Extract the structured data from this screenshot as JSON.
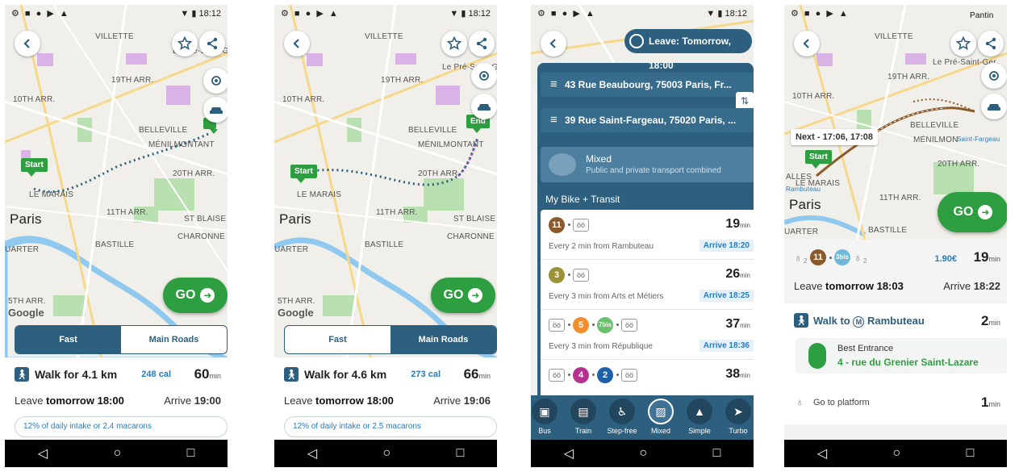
{
  "status": {
    "icons_left": "⚙ ■ ● ▶ ▲",
    "icons_right": "▼ ▮ 18:12"
  },
  "icons": {
    "back": "back-icon",
    "star": "star-icon",
    "share": "share-icon",
    "locate": "locate-icon",
    "car": "car-icon"
  },
  "colors": {
    "primary": "#2d5f7e",
    "green": "#2e9f40",
    "route_dots": "#2d5f7e",
    "accent_blue": "#2a7bbd"
  },
  "map": {
    "labels": {
      "villette": "VILLETTE",
      "arr19": "19TH ARR.",
      "arr10": "10TH ARR.",
      "belleville": "BELLEVILLE",
      "menilmontant": "MÉNILMONTANT",
      "arr20": "20TH ARR.",
      "lemarais": "LE MARAIS",
      "paris": "Paris",
      "arr11": "11TH ARR.",
      "stblaise": "ST BLAISE",
      "charonne": "CHARONNE",
      "bastille": "BASTILLE",
      "quartier": "UARTER",
      "arr5": "5TH ARR.",
      "lepre": "Le Pré-Saint-Ger",
      "pantin": "Pantin",
      "google": "Google"
    }
  },
  "pins": {
    "start": "Start",
    "end": "End"
  },
  "go": {
    "label": "GO",
    "arrow": "➜"
  },
  "phone1": {
    "tabs": [
      "Fast",
      "Main Roads"
    ],
    "walk_text": "Walk for 4.1 km",
    "calories": "248 cal",
    "minutes": "60",
    "min_unit": "min",
    "leave_prefix": "Leave ",
    "leave_time": "tomorrow 18:00",
    "arrive_prefix": "Arrive ",
    "arrive_time": "19:00",
    "macaron": "12% of daily intake or 2.4 macarons"
  },
  "phone2": {
    "tabs": [
      "Fast",
      "Main Roads"
    ],
    "walk_text": "Walk for 4.6 km",
    "calories": "273 cal",
    "minutes": "66",
    "min_unit": "min",
    "leave_prefix": "Leave ",
    "leave_time": "tomorrow 18:00",
    "arrive_prefix": "Arrive ",
    "arrive_time": "19:06",
    "macaron": "12% of daily intake or 2.5 macarons"
  },
  "phone3": {
    "leave_pill": "Leave: Tomorrow, 18:00",
    "from": "43 Rue Beaubourg, 75003 Paris, Fr...",
    "to": "39 Rue Saint-Fargeau, 75020 Paris, ...",
    "swap": "⇅",
    "mode_title": "Mixed",
    "mode_sub": "Public and private transport combined",
    "section": "My Bike + Transit",
    "bike_glyph": "öö",
    "min_unit": "min",
    "routes": [
      {
        "line": "11",
        "color": "#8b5a2b",
        "minutes": "19",
        "every": "Every 2 min from Rambuteau",
        "arrive": "Arrive 18:20"
      },
      {
        "line": "3",
        "color": "#9b9237",
        "minutes": "26",
        "every": "Every 3 min from Arts et Métiers",
        "arrive": "Arrive 18:25"
      },
      {
        "line": "5",
        "line2": "7bis",
        "color": "#f28e2b",
        "color2": "#6cbf6c",
        "minutes": "37",
        "every": "Every 3 min from République",
        "arrive": "Arrive 18:36"
      },
      {
        "line": "4",
        "line2": "2",
        "color": "#b5338f",
        "color2": "#1f5fa8",
        "minutes": "38",
        "every": "",
        "arrive": ""
      }
    ],
    "modes": [
      {
        "label": "Bus",
        "icon": "▣"
      },
      {
        "label": "Train",
        "icon": "▤"
      },
      {
        "label": "Step-free",
        "icon": "♿"
      },
      {
        "label": "Mixed",
        "icon": "▨"
      },
      {
        "label": "Simple",
        "icon": "▲"
      },
      {
        "label": "Turbo",
        "icon": "➤"
      }
    ]
  },
  "phone4": {
    "next": "Next - 17:06, 17:08",
    "rambuteau_map": "Rambuteau",
    "alles": "ALLES",
    "saint_fargeau_map": "Saint-Fargeau",
    "menilmon": "MÉNILMON",
    "price": "1.90€",
    "total_minutes": "19",
    "min_unit": "min",
    "line1": "11",
    "line2": "3bis",
    "walk_glyph": "♁",
    "sub2": "2",
    "leave_prefix": "Leave ",
    "leave_time": "tomorrow 18:03",
    "arrive_prefix": "Arrive ",
    "arrive_time": "18:22",
    "walk_to": "Walk to",
    "metro_glyph": "M",
    "station": "Rambuteau",
    "walk_minutes": "2",
    "entrance_title": "Best Entrance",
    "entrance_sub": "4 - rue du Grenier Saint-Lazare",
    "platform": "Go to platform",
    "platform_minutes": "1"
  },
  "navbar": {
    "back": "◁",
    "home": "○",
    "recent": "□"
  }
}
